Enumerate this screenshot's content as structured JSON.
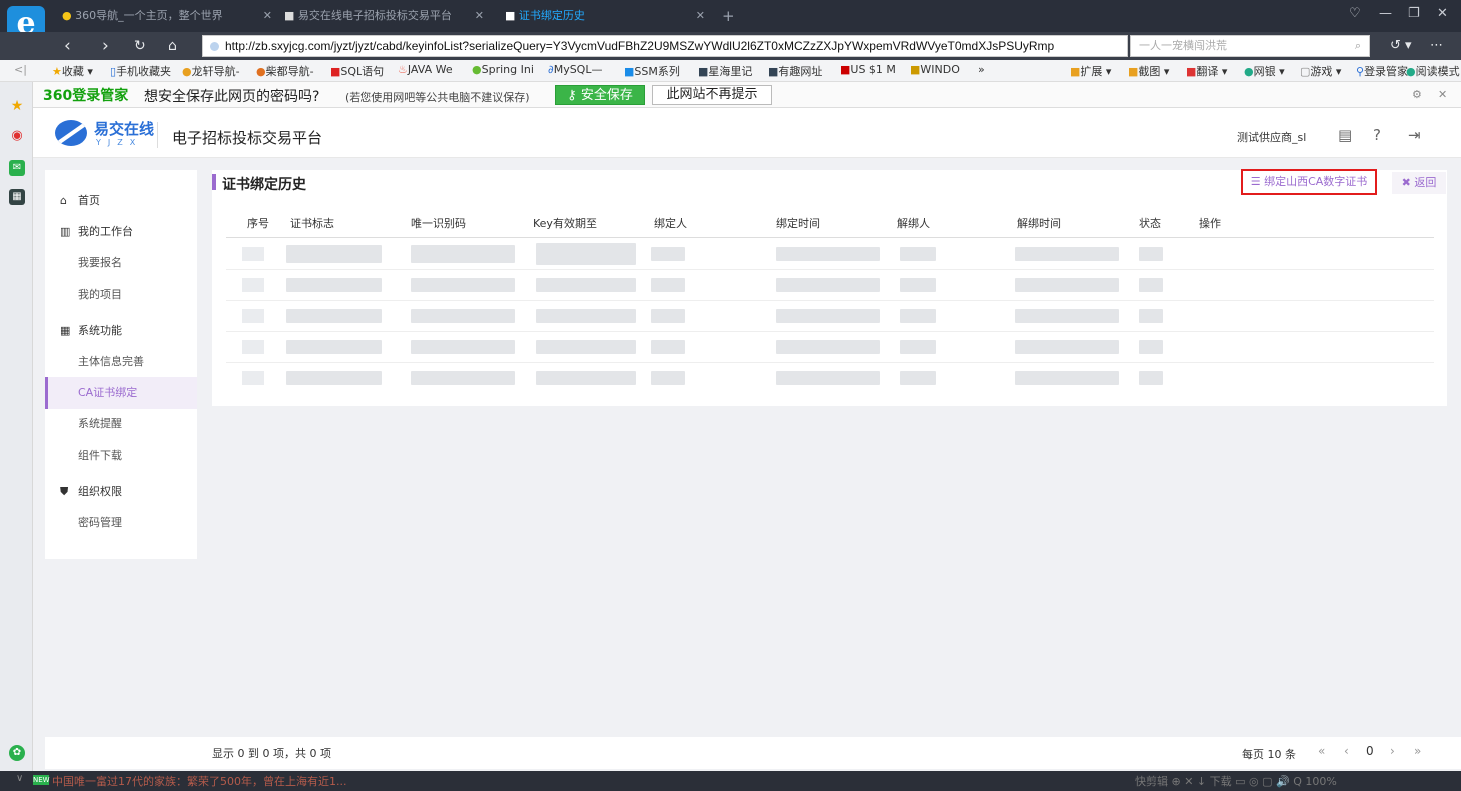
{
  "browser": {
    "tabs": [
      {
        "label": "360导航_一个主页，整个世界",
        "active": false
      },
      {
        "label": "易交在线电子招标投标交易平台",
        "active": false
      },
      {
        "label": "证书绑定历史",
        "active": true
      }
    ],
    "url": "http://zb.sxyjcg.com/jyzt/jyzt/cabd/keyinfoList?serializeQuery=Y3VycmVudFBhZ2U9MSZwYWdlU2l6ZT0xMCZzZXJpYWxpemVRdWVyeT0mdXJsPSUyRmp",
    "search_placeholder": "一人一宠横闯洪荒",
    "bookmarks": [
      "收藏",
      "手机收藏夹",
      "龙轩导航-",
      "柴都导航-",
      "SQL语句",
      "JAVA We",
      "Spring Ini",
      "MySQL—",
      "SSM系列",
      "星海里记",
      "有趣网址",
      "US $1 M",
      "WINDO",
      "»"
    ],
    "toolbar_right": [
      "扩展",
      "截图",
      "翻译",
      "网银",
      "游戏",
      "登录管家",
      "阅读模式"
    ]
  },
  "password_bar": {
    "brand": "360登录管家",
    "message": "想安全保存此网页的密码吗?",
    "hint": "(若您使用网吧等公共电脑不建议保存)",
    "save_label": "安全保存",
    "never_label": "此网站不再提示"
  },
  "app": {
    "brand": "易交在线",
    "brand_sub": "YJZX",
    "platform_name": "电子招标投标交易平台",
    "user_name": "测试供应商_sl"
  },
  "sidebar": {
    "items": [
      {
        "label": "首页",
        "icon": "home-icon",
        "type": "top"
      },
      {
        "label": "我的工作台",
        "icon": "workbench-icon",
        "type": "section"
      },
      {
        "label": "我要报名",
        "type": "sub"
      },
      {
        "label": "我的项目",
        "type": "sub"
      },
      {
        "label": "系统功能",
        "icon": "grid-icon",
        "type": "section"
      },
      {
        "label": "主体信息完善",
        "type": "sub"
      },
      {
        "label": "CA证书绑定",
        "type": "sub",
        "active": true
      },
      {
        "label": "系统提醒",
        "type": "sub"
      },
      {
        "label": "组件下载",
        "type": "sub"
      },
      {
        "label": "组织权限",
        "icon": "shield-icon",
        "type": "section"
      },
      {
        "label": "密码管理",
        "type": "sub"
      }
    ]
  },
  "main": {
    "title": "证书绑定历史",
    "bind_button": "绑定山西CA数字证书",
    "back_button": "返回",
    "columns": [
      "序号",
      "证书标志",
      "唯一识别码",
      "Key有效期至",
      "绑定人",
      "绑定时间",
      "解绑人",
      "解绑时间",
      "状态",
      "操作"
    ],
    "row_count_visible": 5
  },
  "footer": {
    "page_info": "显示 0 到 0 项，共 0 项",
    "page_size": "每页 10 条",
    "current_page": "0"
  },
  "statusbar": {
    "news": "中国唯一富过17代的家族：繁荣了500年，曾在上海有近1...",
    "right": "快剪辑  ⊕  ✕  ↓ 下载  ▭  ◎  ▢  🔊  Q 100%"
  },
  "colors": {
    "accent": "#9b6bcf",
    "highlight_border": "#e21c1c",
    "brand_blue": "#2a6fd6"
  }
}
